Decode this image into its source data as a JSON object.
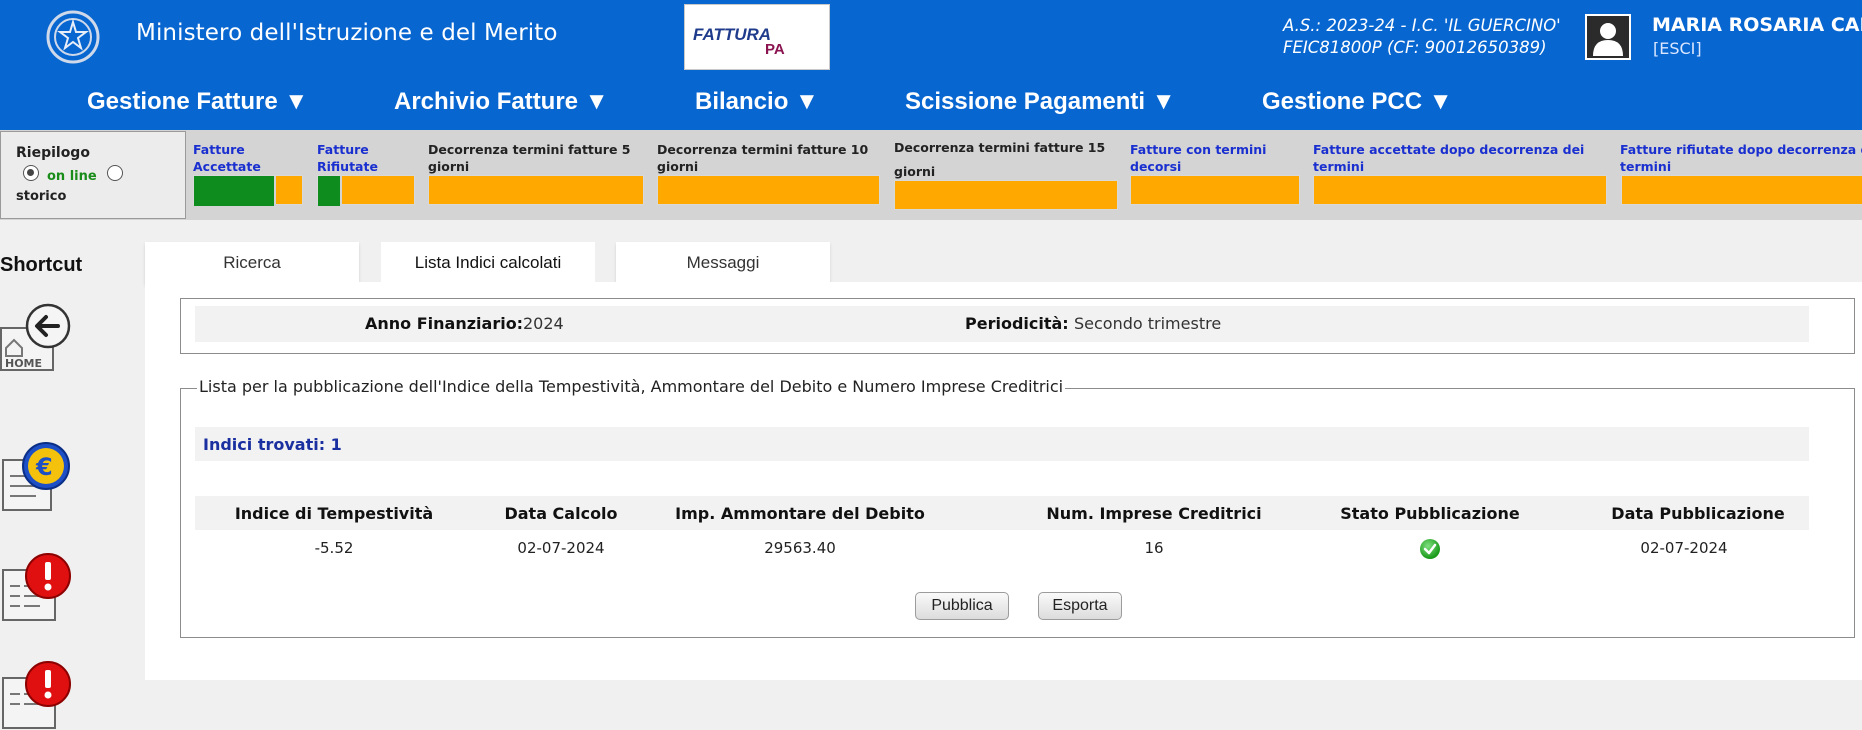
{
  "header": {
    "ministry": "Ministero dell'Istruzione e del Merito",
    "logo_text": "FATTURA",
    "logo_suffix": "PA",
    "school_line1": "A.S.: 2023-24  - I.C. 'IL GUERCINO'",
    "school_line2": "FEIC81800P  (CF: 90012650389)",
    "user_name": "MARIA ROSARIA CALA",
    "logout": "[ESCI]"
  },
  "menu": [
    {
      "label": "Gestione Fatture ▼"
    },
    {
      "label": "Archivio Fatture ▼"
    },
    {
      "label": "Bilancio ▼"
    },
    {
      "label": "Scissione Pagamenti ▼"
    },
    {
      "label": "Gestione PCC ▼"
    }
  ],
  "riepilogo": {
    "title": "Riepilogo",
    "online": "on line",
    "storico": "storico",
    "selected": "on line"
  },
  "kpis": [
    {
      "label": "Fatture Accettate"
    },
    {
      "label": "Fatture Rifiutate"
    },
    {
      "label": "Decorrenza termini fatture 5 giorni"
    },
    {
      "label": "Decorrenza termini fatture 10 giorni"
    },
    {
      "label": "Decorrenza termini fatture 15 giorni"
    },
    {
      "label": "Fatture con termini decorsi"
    },
    {
      "label": "Fatture accettate dopo decorrenza dei termini"
    },
    {
      "label": "Fatture rifiutate dopo decorrenza dei termini"
    }
  ],
  "kpi_levels": {
    "accettate_green": 0.76,
    "rifiutate_green": 0.25
  },
  "colors": {
    "header": "#0866d1",
    "bar_orange": "#ffa800",
    "bar_green": "#0e8c1d",
    "link_blue": "#1a2fd0"
  },
  "sidebar": {
    "title": "Shortcut",
    "items": [
      {
        "icon": "home-icon",
        "label": "HOME"
      },
      {
        "icon": "euro-document-icon"
      },
      {
        "icon": "alert-document-icon"
      },
      {
        "icon": "alert-document-icon"
      }
    ]
  },
  "tabs": [
    {
      "label": "Ricerca"
    },
    {
      "label": "Lista Indici calcolati",
      "active": true
    },
    {
      "label": "Messaggi"
    }
  ],
  "filters": {
    "anno_label": "Anno Finanziario:",
    "anno_value": "2024",
    "periodicita_label": "Periodicità:",
    "periodicita_value": "Secondo trimestre"
  },
  "list": {
    "legend": "Lista per la pubblicazione dell'Indice della Tempestività, Ammontare del Debito e Numero Imprese Creditrici",
    "found": "Indici trovati: 1",
    "columns": [
      "Indice di Tempestività",
      "Data Calcolo",
      "Imp. Ammontare del Debito",
      "Num. Imprese Creditrici",
      "Stato Pubblicazione",
      "Data Pubblicazione"
    ],
    "rows": [
      {
        "indice": "-5.52",
        "data_calcolo": "02-07-2024",
        "importo": "29563.40",
        "num_imprese": "16",
        "stato": "published-check-icon",
        "data_pubblicazione": "02-07-2024"
      }
    ],
    "buttons": {
      "pubblica": "Pubblica",
      "esporta": "Esporta"
    }
  }
}
